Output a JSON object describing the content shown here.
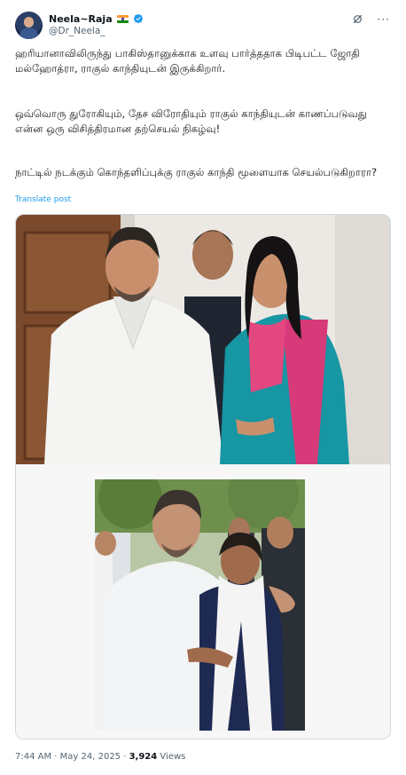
{
  "author": {
    "display_name": "Neela~Raja",
    "handle": "@Dr_Neela_",
    "avatar_icon": "avatar-icon",
    "flag_icon": "india-flag-icon",
    "verified_icon": "verified-badge-icon",
    "verified_color": "#1d9bf0"
  },
  "header_actions": {
    "grok_icon": "grok-icon",
    "more_icon": "more-options-icon",
    "more_glyph": "···"
  },
  "post": {
    "paragraph_1": "ஹரியானாவிலிருந்து பாகிஸ்தானுக்காக உளவு பார்த்ததாக பிடிபட்ட ஜோதி மல்ஹோத்ரா, ராகுல் காந்தியுடன் இருக்கிறார்.",
    "paragraph_2": "ஒவ்வொரு துரோகியும், தேச விரோதியும் ராகுல் காந்தியுடன் காணப்படுவது என்ன ஒரு விசித்திரமான தற்செயல் நிகழ்வு!",
    "paragraph_3": "நாட்டில் நடக்கும் கொந்தளிப்புக்கு ராகுல் காந்தி மூளையாக செயல்படுகிறாரா?",
    "translate_label": "Translate post"
  },
  "media": {
    "photo_1_icon": "photo-image",
    "photo_2_icon": "photo-image"
  },
  "meta": {
    "time": "7:44 AM",
    "separator_1": " · ",
    "date": "May 24, 2025",
    "separator_2": " · ",
    "views_count": "3,924",
    "views_label": " Views"
  },
  "colors": {
    "text_primary": "#0f1419",
    "text_secondary": "#536471",
    "link": "#1d9bf0",
    "border": "#cfd9de"
  }
}
